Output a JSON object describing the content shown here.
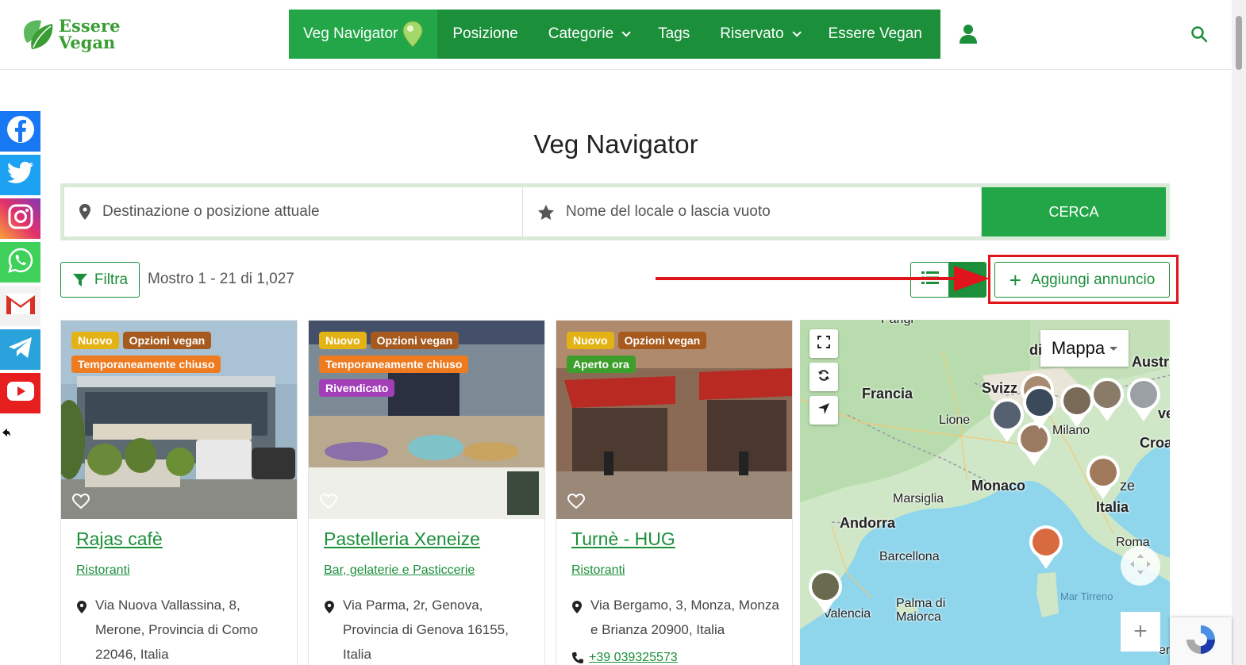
{
  "header": {
    "logo_line1": "Essere",
    "logo_line2": "Vegan",
    "nav": [
      {
        "label": "Veg Navigator",
        "active": true,
        "dropdown": false
      },
      {
        "label": "Posizione",
        "dropdown": false
      },
      {
        "label": "Categorie",
        "dropdown": true
      },
      {
        "label": "Tags",
        "dropdown": false
      },
      {
        "label": "Riservato",
        "dropdown": true
      },
      {
        "label": "Essere Vegan",
        "dropdown": false
      }
    ],
    "user_icon": "user-icon",
    "search_icon": "search-icon"
  },
  "social": [
    "facebook-icon",
    "twitter-icon",
    "instagram-icon",
    "whatsapp-icon",
    "gmail-icon",
    "telegram-icon",
    "youtube-icon"
  ],
  "page_title": "Veg Navigator",
  "search": {
    "location_placeholder": "Destinazione o posizione attuale",
    "name_placeholder": "Nome del locale o lascia vuoto",
    "button_label": "CERCA"
  },
  "toolbar": {
    "filter_label": "Filtra",
    "result_count": "Mostro 1 - 21 di 1,027",
    "add_label": "Aggiungi annuncio"
  },
  "cards": [
    {
      "title": "Rajas cafè",
      "category": "Ristoranti",
      "badges_row1": [
        "Nuovo",
        "Opzioni vegan"
      ],
      "badges_row2": [
        "Temporaneamente chiuso"
      ],
      "badges_row3": [],
      "address": "Via Nuova Vallassina, 8, Merone, Provincia di Como 22046, Italia",
      "phone": ""
    },
    {
      "title": "Pastelleria Xeneize",
      "category": "Bar, gelaterie e Pasticcerie",
      "badges_row1": [
        "Nuovo",
        "Opzioni vegan"
      ],
      "badges_row2": [
        "Temporaneamente chiuso"
      ],
      "badges_row3": [
        "Rivendicato"
      ],
      "address": "Via Parma, 2r, Genova, Provincia di Genova 16155, Italia",
      "phone": ""
    },
    {
      "title": "Turnè - HUG",
      "category": "Ristoranti",
      "badges_row1": [
        "Nuovo",
        "Opzioni vegan"
      ],
      "badges_row2": [
        "Aperto ora"
      ],
      "badges_row3": [],
      "address": "Via Bergamo, 3, Monza, Monza e Brianza 20900, Italia",
      "phone": "+39 039325573"
    }
  ],
  "map": {
    "type_label": "Mappa",
    "labels": [
      "Francia",
      "Svizz",
      "Austri",
      "Lione",
      "Milano",
      "Croa",
      "Monaco",
      "Marsiglia",
      "ze",
      "Italia",
      "Andorra",
      "Roma",
      "Barcellona",
      "Palma di Maiorca",
      "Valencia",
      "Mar Tirreno",
      "di",
      "Parigi",
      "er",
      "ve"
    ]
  }
}
